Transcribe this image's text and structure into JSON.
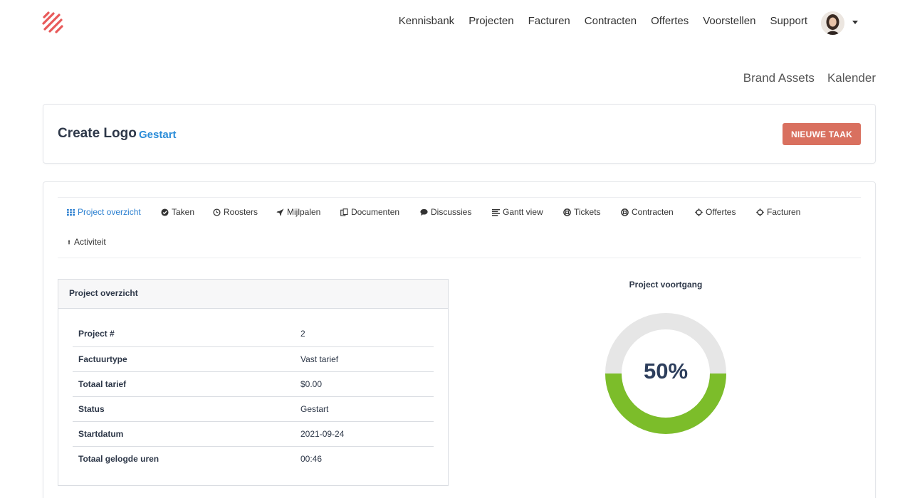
{
  "nav": {
    "items": [
      "Kennisbank",
      "Projecten",
      "Facturen",
      "Contracten",
      "Offertes",
      "Voorstellen",
      "Support"
    ]
  },
  "subnav": {
    "items": [
      "Brand Assets",
      "Kalender"
    ]
  },
  "project": {
    "title": "Create Logo",
    "status": "Gestart",
    "new_task_label": "NIEUWE TAAK"
  },
  "tabs": [
    {
      "label": "Project overzicht",
      "icon": "grid-icon",
      "active": true
    },
    {
      "label": "Taken",
      "icon": "check-circle-icon"
    },
    {
      "label": "Roosters",
      "icon": "clock-icon"
    },
    {
      "label": "Mijlpalen",
      "icon": "rocket-icon"
    },
    {
      "label": "Documenten",
      "icon": "copy-icon"
    },
    {
      "label": "Discussies",
      "icon": "comment-icon"
    },
    {
      "label": "Gantt view",
      "icon": "align-left-icon"
    },
    {
      "label": "Tickets",
      "icon": "life-ring-icon"
    },
    {
      "label": "Contracten",
      "icon": "life-ring-icon"
    },
    {
      "label": "Offertes",
      "icon": "gear-icon"
    },
    {
      "label": "Facturen",
      "icon": "gear-icon"
    },
    {
      "label": "Activiteit",
      "icon": "exclamation-icon"
    }
  ],
  "overview": {
    "heading": "Project overzicht",
    "rows": [
      {
        "key": "Project #",
        "value": "2"
      },
      {
        "key": "Factuurtype",
        "value": "Vast tarief"
      },
      {
        "key": "Totaal tarief",
        "value": "$0.00"
      },
      {
        "key": "Status",
        "value": "Gestart"
      },
      {
        "key": "Startdatum",
        "value": "2021-09-24"
      },
      {
        "key": "Totaal gelogde uren",
        "value": "00:46"
      }
    ]
  },
  "progress": {
    "title": "Project voortgang",
    "value": 50,
    "label": "50%"
  },
  "colors": {
    "accent": "#2a8cd8",
    "button": "#d9705f",
    "progress_fill": "#7cbd2a",
    "progress_track": "#e6e6e6",
    "logo": "#e85a5a"
  }
}
